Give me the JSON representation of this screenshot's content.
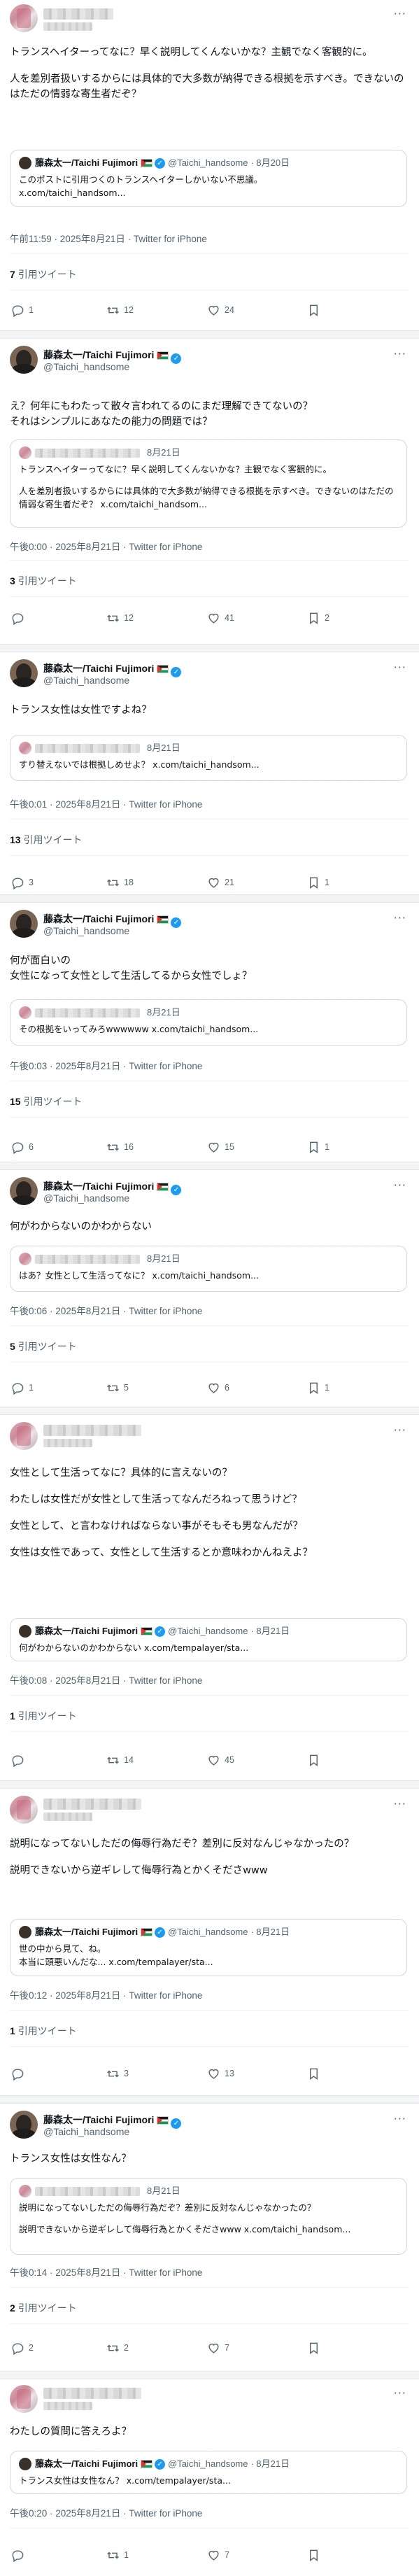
{
  "common": {
    "via": "Twitter for iPhone",
    "quote_tweets_label": "引用ツイート",
    "more": "···",
    "verified": "✓"
  },
  "taichi": {
    "name": "藤森太一/Taichi Fujimori",
    "handle": "@Taichi_handsome"
  },
  "tweets": [
    {
      "paragraphs": [
        "トランスヘイターってなに？早く説明してくんないかな？主観でなく客観的に。",
        "人を差別者扱いするからには具体的で大多数が納得できる根拠を示すべき。できないのはただの情弱な寄生者だぞ？"
      ],
      "quote": {
        "name": "藤森太一/Taichi Fujimori",
        "handle": "@Taichi_handsome",
        "date": "· 8月20日",
        "lines": [
          "このポストに引用つくのトランスヘイターしかいない不思議。",
          "x.com/taichi_handsom..."
        ]
      },
      "meta": "午前11:59 · 2025年8月21日 · Twitter for iPhone",
      "quote_count": "7",
      "replies": "1",
      "retweets": "12",
      "likes": "24",
      "bookmarks": ""
    },
    {
      "name": "藤森太一/Taichi Fujimori",
      "handle": "@Taichi_handsome",
      "paragraphs": [
        "え？何年にもわたって散々言われてるのにまだ理解できてないの？\nそれはシンプルにあなたの能力の問題では？"
      ],
      "quote": {
        "date": "8月21日",
        "paragraphs": [
          "トランスヘイターってなに？早く説明してくんないかな？主観でなく客観的に。",
          "人を差別者扱いするからには具体的で大多数が納得できる根拠を示すべき。できないのはただの情弱な寄生者だぞ？ x.com/taichi_handsom..."
        ]
      },
      "meta": "午後0:00 · 2025年8月21日 · Twitter for iPhone",
      "quote_count": "3",
      "replies": "",
      "retweets": "12",
      "likes": "41",
      "bookmarks": "2"
    },
    {
      "name": "藤森太一/Taichi Fujimori",
      "handle": "@Taichi_handsome",
      "paragraphs": [
        "トランス女性は女性ですよね？"
      ],
      "quote": {
        "date": "8月21日",
        "lines": [
          "すり替えないでは根拠しめせよ？ x.com/taichi_handsom..."
        ]
      },
      "meta": "午後0:01 · 2025年8月21日 · Twitter for iPhone",
      "quote_count": "13",
      "replies": "3",
      "retweets": "18",
      "likes": "21",
      "bookmarks": "1"
    },
    {
      "name": "藤森太一/Taichi Fujimori",
      "handle": "@Taichi_handsome",
      "paragraphs": [
        "何が面白いの\n女性になって女性として生活してるから女性でしょ？"
      ],
      "quote": {
        "date": "8月21日",
        "lines": [
          "その根拠をいってみろwwwwww x.com/taichi_handsom..."
        ]
      },
      "meta": "午後0:03 · 2025年8月21日 · Twitter for iPhone",
      "quote_count": "15",
      "replies": "6",
      "retweets": "16",
      "likes": "15",
      "bookmarks": "1"
    },
    {
      "name": "藤森太一/Taichi Fujimori",
      "handle": "@Taichi_handsome",
      "paragraphs": [
        "何がわからないのかわからない"
      ],
      "quote": {
        "date": "8月21日",
        "lines": [
          "はあ？女性として生活ってなに？ x.com/taichi_handsom..."
        ]
      },
      "meta": "午後0:06 · 2025年8月21日 · Twitter for iPhone",
      "quote_count": "5",
      "replies": "1",
      "retweets": "5",
      "likes": "6",
      "bookmarks": "1"
    },
    {
      "paragraphs": [
        "女性として生活ってなに？具体的に言えないの？",
        "わたしは女性だが女性として生活ってなんだろねって思うけど？",
        "女性として、と言わなければならない事がそもそも男なんだが？",
        "女性は女性であって、女性として生活するとか意味わかんねえよ？"
      ],
      "quote": {
        "name": "藤森太一/Taichi Fujimori",
        "handle": "@Taichi_handsome",
        "date": "· 8月21日",
        "lines": [
          "何がわからないのかわからない x.com/tempalayer/sta..."
        ]
      },
      "meta": "午後0:08 · 2025年8月21日 · Twitter for iPhone",
      "quote_count": "1",
      "replies": "",
      "retweets": "14",
      "likes": "45",
      "bookmarks": ""
    },
    {
      "paragraphs": [
        "説明になってないしただの侮辱行為だぞ？差別に反対なんじゃなかったの？",
        "説明できないから逆ギレして侮辱行為とかくそださwww"
      ],
      "quote": {
        "name": "藤森太一/Taichi Fujimori",
        "handle": "@Taichi_handsome",
        "date": "· 8月21日",
        "lines": [
          "世の中から見て、ね。",
          "本当に頭悪いんだな... x.com/tempalayer/sta..."
        ]
      },
      "meta": "午後0:12 · 2025年8月21日 · Twitter for iPhone",
      "quote_count": "1",
      "replies": "",
      "retweets": "3",
      "likes": "13",
      "bookmarks": ""
    },
    {
      "name": "藤森太一/Taichi Fujimori",
      "handle": "@Taichi_handsome",
      "paragraphs": [
        "トランス女性は女性なん？"
      ],
      "quote": {
        "date": "8月21日",
        "paragraphs": [
          "説明になってないしただの侮辱行為だぞ？差別に反対なんじゃなかったの？",
          "説明できないから逆ギレして侮辱行為とかくそださwww x.com/taichi_handsom..."
        ]
      },
      "meta": "午後0:14 · 2025年8月21日 · Twitter for iPhone",
      "quote_count": "2",
      "replies": "2",
      "retweets": "2",
      "likes": "7",
      "bookmarks": ""
    },
    {
      "paragraphs": [
        "わたしの質問に答えろよ？"
      ],
      "quote": {
        "name": "藤森太一/Taichi Fujimori",
        "handle": "@Taichi_handsome",
        "date": "· 8月21日",
        "lines": [
          "トランス女性は女性なん？ x.com/tempalayer/sta..."
        ]
      },
      "meta": "午後0:20 · 2025年8月21日 · Twitter for iPhone",
      "replies": "",
      "retweets": "1",
      "likes": "7",
      "bookmarks": ""
    }
  ]
}
